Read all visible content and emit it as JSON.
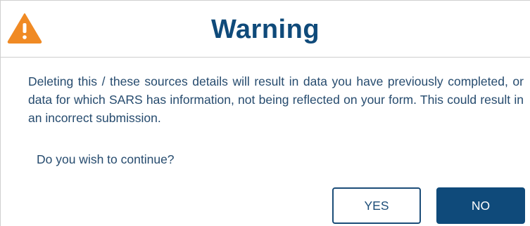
{
  "dialog": {
    "title": "Warning",
    "icon": "warning-triangle-icon",
    "message": "Deleting this / these sources details will result in data you have previously completed, or data for which SARS has information, not being reflected on your form. This could result in an incorrect submission.",
    "question": "Do you wish to continue?",
    "buttons": {
      "yes_label": "YES",
      "no_label": "NO"
    }
  },
  "colors": {
    "title": "#0f4a7a",
    "text": "#264b6e",
    "warning_icon": "#f08a24",
    "primary_button": "#0f4a7a"
  }
}
